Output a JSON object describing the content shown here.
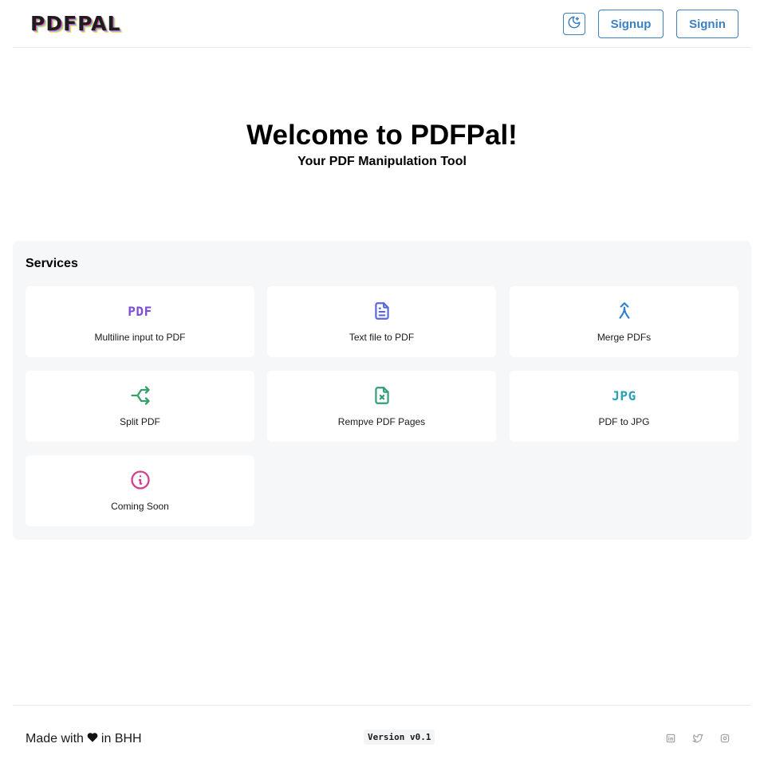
{
  "header": {
    "logo_text": "PDFPAL",
    "theme_toggle_icon": "moon-icon",
    "signup_label": "Signup",
    "signin_label": "Signin"
  },
  "hero": {
    "title": "Welcome to PDFPal!",
    "subtitle": "Your PDF Manipulation Tool"
  },
  "services": {
    "title": "Services",
    "items": [
      {
        "label": "Multiline input to PDF",
        "icon": "pdf-text-icon",
        "icon_text": "PDF",
        "color": "#7c4fd6"
      },
      {
        "label": "Text file to PDF",
        "icon": "file-text-icon",
        "color": "#5a67d8"
      },
      {
        "label": "Merge PDFs",
        "icon": "merge-icon",
        "color": "#3182ce"
      },
      {
        "label": "Split PDF",
        "icon": "split-icon",
        "color": "#38a169"
      },
      {
        "label": "Rempve PDF Pages",
        "icon": "file-x-icon",
        "color": "#2f9e74"
      },
      {
        "label": "PDF to JPG",
        "icon": "jpg-text-icon",
        "icon_text": "JPG",
        "color": "#2b9fb3"
      },
      {
        "label": "Coming Soon",
        "icon": "info-circle-icon",
        "color": "#d53f8c"
      }
    ]
  },
  "footer": {
    "made_prefix": "Made with",
    "made_suffix": "in BHH",
    "heart_icon": "heart-icon",
    "version": "Version v0.1",
    "social": [
      "linkedin-icon",
      "twitter-icon",
      "instagram-icon"
    ]
  },
  "colors": {
    "accent": "#3c7fc2",
    "services_bg": "#f6f7f9",
    "divider": "#e8ecf0"
  }
}
